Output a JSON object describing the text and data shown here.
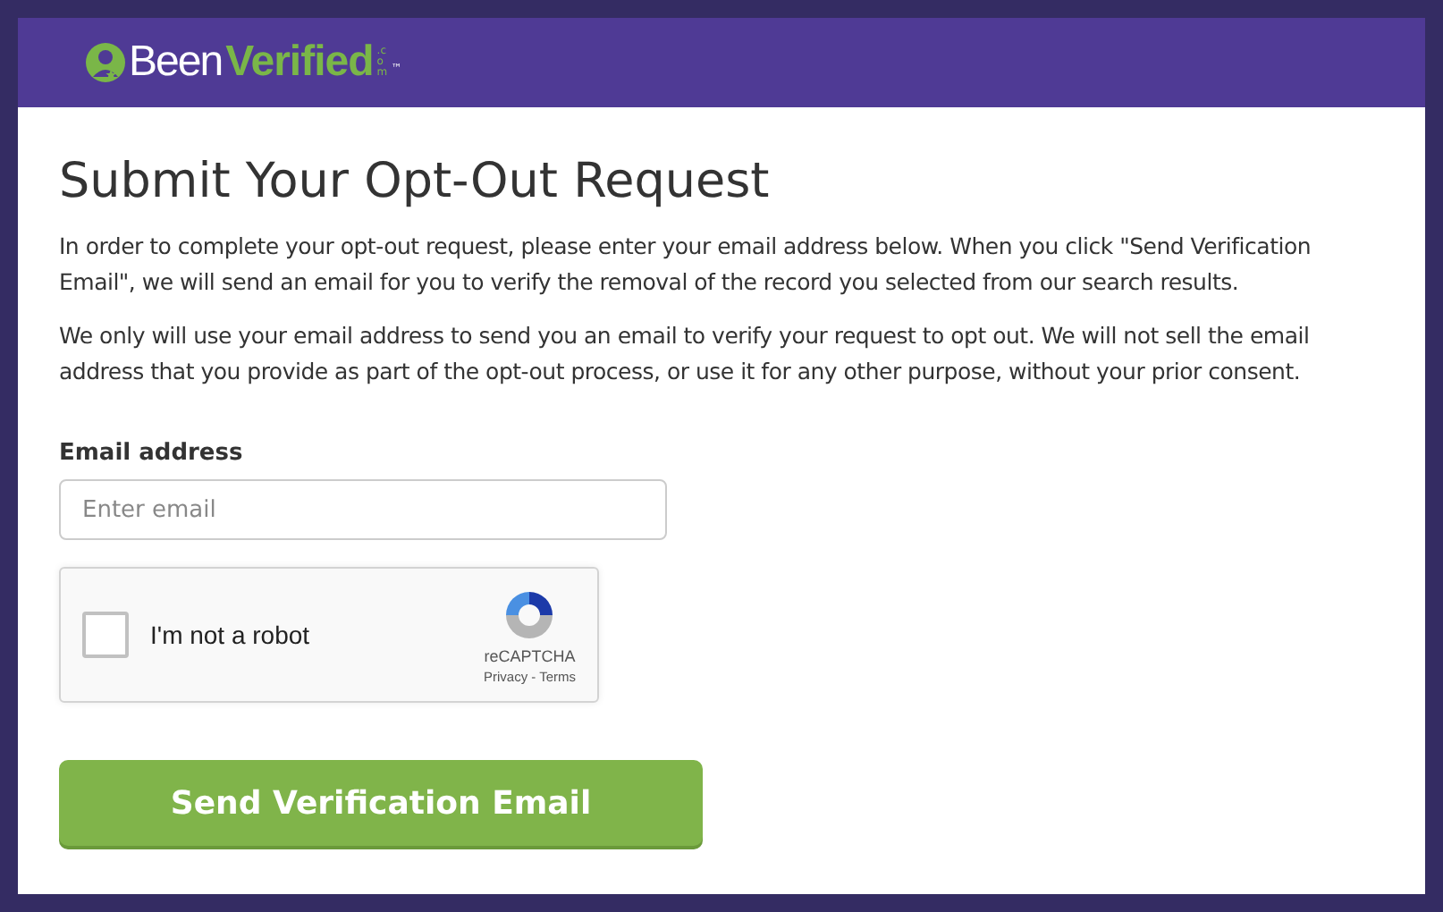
{
  "header": {
    "logo": {
      "plain": "Been",
      "accent": "Verified",
      "suffix": ".com",
      "mark": "™"
    }
  },
  "title": "Submit Your Opt-Out Request",
  "paragraphs": [
    "In order to complete your opt-out request, please enter your email address below. When you click \"Send Verification Email\", we will send an email for you to verify the removal of the record you selected from our search results.",
    "We only will use your email address to send you an email to verify your request to opt out. We will not sell the email address that you provide as part of the opt-out process, or use it for any other purpose, without your prior consent."
  ],
  "email_field": {
    "label": "Email address",
    "placeholder": "Enter email"
  },
  "captcha": {
    "label": "I'm not a robot",
    "checked": false,
    "brand": "reCAPTCHA",
    "links": [
      "Privacy",
      "Terms"
    ],
    "separator": "-"
  },
  "submit_button": "Send Verification Email"
}
